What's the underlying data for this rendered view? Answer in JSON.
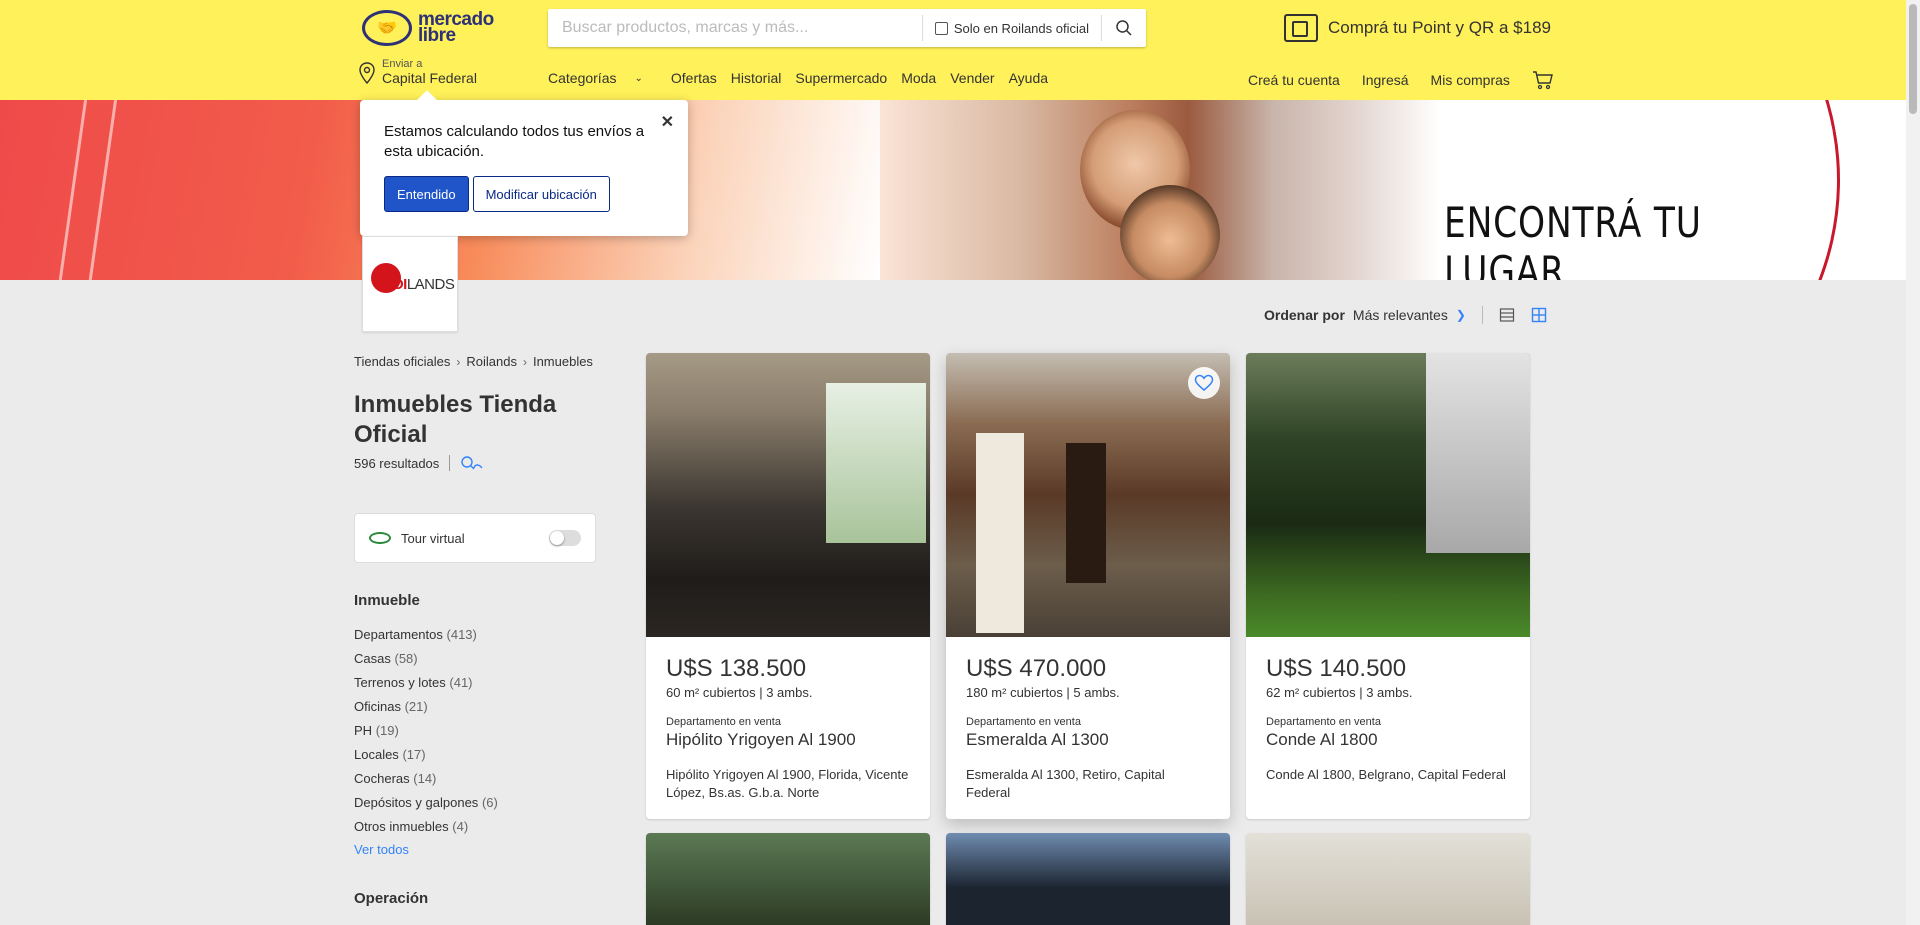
{
  "header": {
    "logo_text_1": "mercado",
    "logo_text_2": "libre",
    "search_placeholder": "Buscar productos, marcas y más...",
    "official_store_label": "Solo en Roilands oficial",
    "promo": "Comprá tu Point y QR a $189",
    "location_line1": "Enviar a",
    "location_line2": "Capital Federal",
    "nav": [
      {
        "label": "Categorías"
      },
      {
        "label": "Ofertas"
      },
      {
        "label": "Historial"
      },
      {
        "label": "Supermercado"
      },
      {
        "label": "Moda"
      },
      {
        "label": "Vender"
      },
      {
        "label": "Ayuda"
      }
    ],
    "user_nav": [
      {
        "label": "Creá tu cuenta"
      },
      {
        "label": "Ingresá"
      },
      {
        "label": "Mis compras"
      }
    ]
  },
  "banner": {
    "slogan": "ENCONTRÁ TU LUGAR"
  },
  "popup": {
    "message": "Estamos calculando todos tus envíos a esta ubicación.",
    "primary": "Entendido",
    "secondary": "Modificar ubicación",
    "close": "✕"
  },
  "store": {
    "name_red": "ROI",
    "name_dark": "LANDS"
  },
  "sort": {
    "label": "Ordenar por",
    "value": "Más relevantes"
  },
  "breadcrumb": [
    "Tiendas oficiales",
    "Roilands",
    "Inmuebles"
  ],
  "page": {
    "title": "Inmuebles Tienda Oficial",
    "results": "596 resultados"
  },
  "tour": {
    "label": "Tour virtual",
    "enabled": false
  },
  "filters": {
    "inmueble_title": "Inmueble",
    "items": [
      {
        "name": "Departamentos",
        "count": "(413)"
      },
      {
        "name": "Casas",
        "count": "(58)"
      },
      {
        "name": "Terrenos y lotes",
        "count": "(41)"
      },
      {
        "name": "Oficinas",
        "count": "(21)"
      },
      {
        "name": "PH",
        "count": "(19)"
      },
      {
        "name": "Locales",
        "count": "(17)"
      },
      {
        "name": "Cocheras",
        "count": "(14)"
      },
      {
        "name": "Depósitos y galpones",
        "count": "(6)"
      },
      {
        "name": "Otros inmuebles",
        "count": "(4)"
      }
    ],
    "see_all": "Ver todos",
    "operacion_title": "Operación"
  },
  "listings": [
    {
      "price": "U$S 138.500",
      "area": "60 m² cubiertos | 3 ambs.",
      "kind": "Departamento en venta",
      "address": "Hipólito Yrigoyen Al 1900",
      "location": "Hipólito Yrigoyen Al 1900, Florida, Vicente López, Bs.as. G.b.a. Norte"
    },
    {
      "price": "U$S 470.000",
      "area": "180 m² cubiertos | 5 ambs.",
      "kind": "Departamento en venta",
      "address": "Esmeralda Al 1300",
      "location": "Esmeralda Al 1300, Retiro, Capital Federal"
    },
    {
      "price": "U$S 140.500",
      "area": "62 m² cubiertos | 3 ambs.",
      "kind": "Departamento en venta",
      "address": "Conde Al 1800",
      "location": "Conde Al 1800, Belgrano, Capital Federal"
    }
  ]
}
